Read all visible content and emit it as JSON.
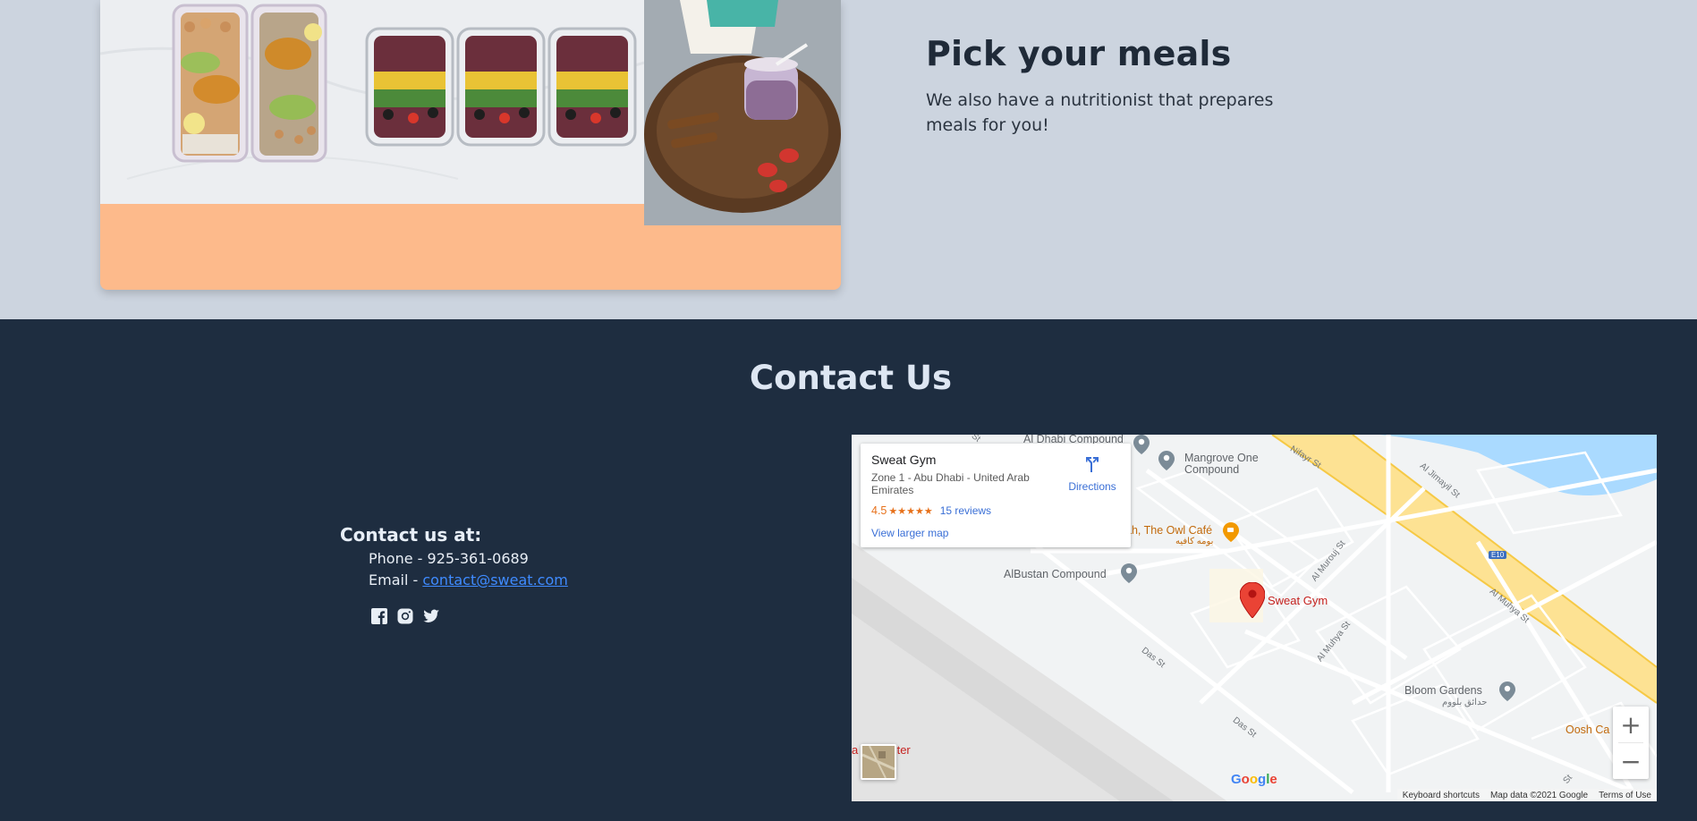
{
  "meals": {
    "title": "Pick your meals",
    "description": "We also have a nutritionist that prepares meals for you!"
  },
  "contact": {
    "title": "Contact Us",
    "heading": "Contact us at:",
    "phone_prefix": "Phone - ",
    "phone": "925-361-0689",
    "email_prefix": "Email - ",
    "email": "contact@sweat.com",
    "socials": [
      "facebook-icon",
      "instagram-icon",
      "twitter-icon"
    ]
  },
  "map": {
    "place_name": "Sweat Gym",
    "address": "Zone 1 - Abu Dhabi - United Arab Emirates",
    "rating": "4.5",
    "stars": "★★★★★",
    "reviews": "15 reviews",
    "directions": "Directions",
    "view_larger": "View larger map",
    "marker_label": "Sweat Gym",
    "labels": {
      "dhabi": "Al Dhabi Compound",
      "mangrove": "Mangrove One Compound",
      "owl": "ah, The Owl Café",
      "owl_ar": "بومه كافيه",
      "albustan": "AlBustan Compound",
      "bloom": "Bloom Gardens",
      "bloom_ar": "حدائق بلووم",
      "oosh": "Oosh Ca",
      "center": "a l    il Center",
      "nifayr": "Nifayr St",
      "jimayil": "Al Jimayil St",
      "e10": "E10",
      "murouj": "Al Murouj St",
      "muhyar": "Al Muhya St",
      "muhya2": "Al Muhya St",
      "das1": "Das St",
      "das2": "Das St",
      "st1": "St",
      "st2": "St"
    },
    "zoom_in": "+",
    "zoom_out": "−",
    "footer": {
      "shortcuts": "Keyboard shortcuts",
      "data": "Map data ©2021 Google",
      "terms": "Terms of Use"
    },
    "google": [
      "G",
      "o",
      "o",
      "g",
      "l",
      "e"
    ],
    "colors": {
      "highway": "#fde293",
      "water": "#aadaff",
      "marker": "#ea4335"
    }
  },
  "colors": {
    "page_bg": "#ccd4df",
    "footer_bg": "#1e2d40",
    "card_accent": "#fdba8b",
    "link": "#3f8bff"
  }
}
